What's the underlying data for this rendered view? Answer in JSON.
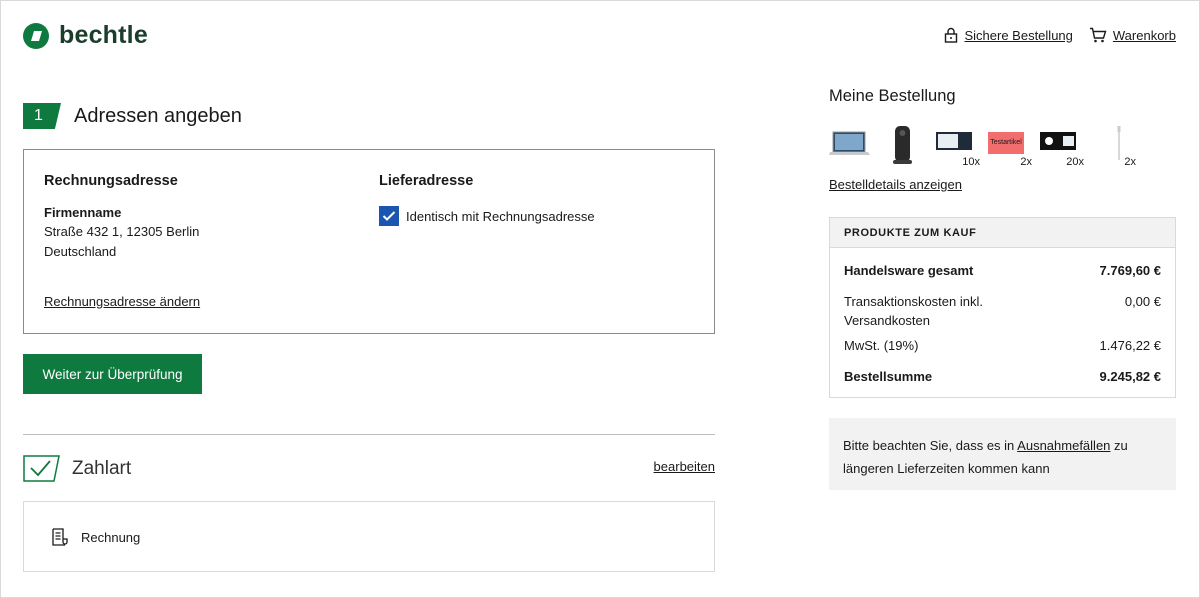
{
  "brand": {
    "name": "bechtle",
    "color": "#0f7a3f"
  },
  "header": {
    "secure_order": "Sichere Bestellung",
    "cart": "Warenkorb"
  },
  "step1": {
    "number": "1",
    "title": "Adressen angeben",
    "billing": {
      "heading": "Rechnungsadresse",
      "company": "Firmenname",
      "street": "Straße 432 1, 12305 Berlin",
      "country": "Deutschland",
      "change_link": "Rechnungsadresse ändern"
    },
    "delivery": {
      "heading": "Lieferadresse",
      "same_as_billing_label": "Identisch mit Rechnungsadresse",
      "same_as_billing_checked": true
    },
    "continue_button": "Weiter zur Überprüfung"
  },
  "step2": {
    "title": "Zahlart",
    "edit_link": "bearbeiten",
    "method": "Rechnung"
  },
  "order": {
    "title": "Meine Bestellung",
    "items": [
      {
        "icon": "laptop-thumb",
        "qty": ""
      },
      {
        "icon": "speaker-thumb",
        "qty": ""
      },
      {
        "icon": "toner-box-thumb",
        "qty": "10x"
      },
      {
        "icon": "test-item-thumb",
        "qty": "2x",
        "label": "Testartikel"
      },
      {
        "icon": "toner-box-dark-thumb",
        "qty": "20x"
      },
      {
        "icon": "cable-thumb",
        "qty": "2x"
      }
    ],
    "details_link": "Bestelldetails anzeigen"
  },
  "summary": {
    "heading": "PRODUKTE ZUM KAUF",
    "merchandise_label": "Handelsware gesamt",
    "merchandise_value": "7.769,60 €",
    "transaction_label_1": "Transaktionskosten inkl.",
    "transaction_label_2": "Versandkosten",
    "transaction_value": "0,00 €",
    "vat_label": "MwSt. (19%)",
    "vat_value": "1.476,22 €",
    "total_label": "Bestellsumme",
    "total_value": "9.245,82 €"
  },
  "notice": {
    "before": "Bitte beachten Sie, dass es in ",
    "link": "Ausnahmefällen",
    "after": " zu",
    "line2": "längeren Lieferzeiten kommen kann"
  }
}
